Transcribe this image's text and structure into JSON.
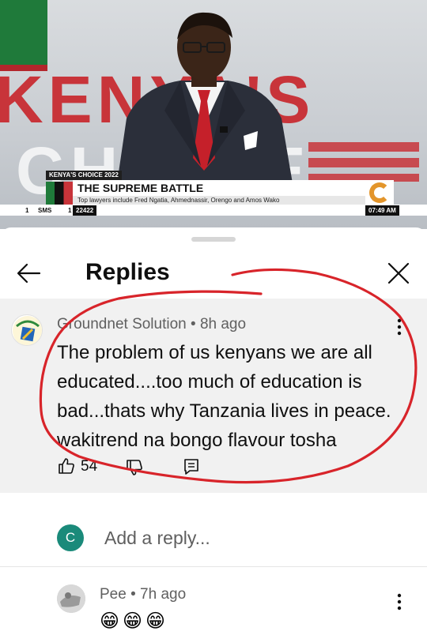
{
  "video": {
    "bg_text_top": "KENYA'S",
    "bg_text_bottom": "CHOICE",
    "program_label": "KENYA'S CHOICE 2022",
    "headline": "THE SUPREME BATTLE",
    "subheadline": "Top lawyers include Fred Ngatia, Ahmednassir, Orengo and Amos Wako",
    "ticker_sms": "SMS",
    "ticker_number": "22422",
    "ticker_time": "07:49 AM",
    "ticker_sep1": "1",
    "ticker_sep2": "1",
    "logo_icon": "citizen-tv-logo",
    "colors": {
      "green": "#1f7a3a",
      "red": "#c8343a",
      "orange": "#e3952b"
    }
  },
  "sheet": {
    "title": "Replies",
    "back_icon": "arrow-left-icon",
    "close_icon": "close-icon"
  },
  "comment": {
    "author": "Groundnet Solution",
    "time": "8h ago",
    "separator": " • ",
    "text": "The problem of us kenyans we are all educated....too much of education is bad...thats why Tanzania lives in peace. wakitrend na bongo flavour  tosha",
    "likes": "54",
    "icons": [
      "thumbs-up-icon",
      "thumbs-down-icon",
      "reply-icon",
      "more-vert-icon"
    ]
  },
  "add_reply": {
    "avatar_letter": "C",
    "placeholder": "Add a reply..."
  },
  "reply": {
    "author": "Pee",
    "time": "7h ago",
    "separator": " • ",
    "text": "😁😁😁"
  },
  "annotation_color": "#d8242a"
}
